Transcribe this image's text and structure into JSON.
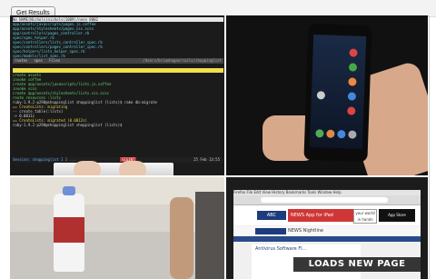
{
  "toolbar": {
    "get_results_label": "Get Results"
  },
  "terminal": {
    "lines_top": [
      "app/assets/javascripts/pages.js.coffee",
      "app/assets/stylesheets/pages.css.scss",
      "app/controllers/pages_controller.rb",
      "spec/spec_helper.rb",
      "spec/controllers/lists_controller_spec.rb",
      "spec/controllers/pages_controller_spec.rb",
      "spec/helpers/lists_helper_spec.rb",
      "spec/models/list_spec.rb"
    ],
    "tabs": [
      "routes",
      "spec",
      "Files"
    ],
    "path": "/Users/brianhogan/rails/shoppinglist",
    "generate_lines": [
      "create    assets",
      "invoke    coffee",
      "create    app/assets/javascripts/lists.js.coffee",
      "invoke    scss",
      "create    app/assets/stylesheets/lists.css.scss",
      "route     resources :lists",
      "ruby-1.9.2-p290@shoppinglist shoppinglist (lists)$ rake db:migrate",
      "== CreateLists: migrating",
      "-- create_table(:lists)",
      "   -> 0.0011s",
      "== CreateLists: migrated (0.0012s)",
      "ruby-1.9.2-p290@shoppinglist shoppinglist (lists)$"
    ],
    "status_left": "Session: shoppinglist 1 1 ...",
    "status_red": "SIGINT",
    "status_time": "25 Feb 13:55"
  },
  "browser": {
    "menu": "Firefox  File  Edit  View  History  Bookmarks  Tools  Window  Help",
    "news_logo": "ABC",
    "ad_text": "NEWS App for iPad",
    "ad_words": "your world in hands",
    "store_text": "App Store",
    "site_name": "NEWS",
    "site_section": "Nightline",
    "headline": "Antivirus Software Fl...",
    "overlay_text": "LOADS NEW PAGE"
  },
  "colors": {
    "terminal_bg": "#1b1b1b",
    "highlight_yellow": "#f1e04a",
    "status_red": "#c83030",
    "news_blue": "#1d3c7c"
  }
}
